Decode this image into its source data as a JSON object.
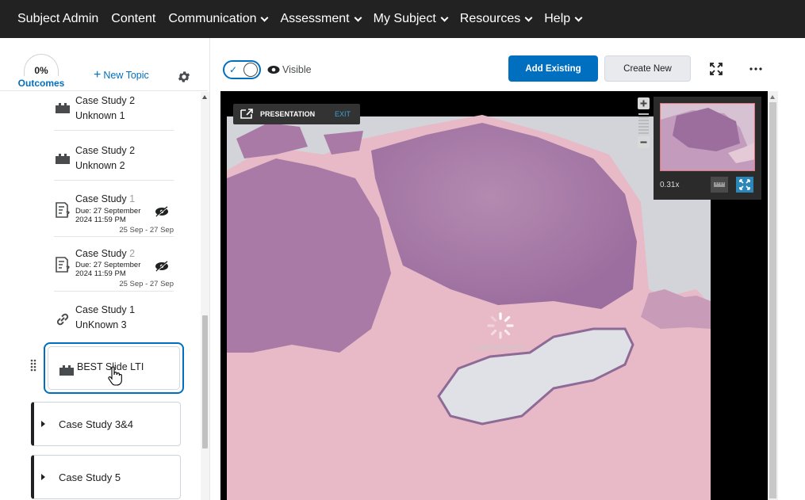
{
  "nav": {
    "items": [
      {
        "label": "Subject Admin",
        "dropdown": false
      },
      {
        "label": "Content",
        "dropdown": false
      },
      {
        "label": "Communication",
        "dropdown": true
      },
      {
        "label": "Assessment",
        "dropdown": true
      },
      {
        "label": "My Subject",
        "dropdown": true
      },
      {
        "label": "Resources",
        "dropdown": true
      },
      {
        "label": "Help",
        "dropdown": true
      }
    ]
  },
  "sidebar": {
    "outcomes_value": "0%",
    "outcomes_label": "Outcomes",
    "new_topic_label": "New Topic",
    "topics": [
      {
        "title": "Case Study 2",
        "title2": "Unknown 1",
        "icon": "lti-icon"
      },
      {
        "title": "Case Study 2",
        "title2": "Unknown 2",
        "icon": "lti-icon"
      },
      {
        "title_main": "Case Study ",
        "title_num": "1",
        "due": "Due: 27 September",
        "due2": "2024 11:59 PM",
        "dates": "25 Sep - 27 Sep",
        "icon": "quiz-icon"
      },
      {
        "title_main": "Case Study ",
        "title_num": "2",
        "due": "Due: 27 September",
        "due2": "2024 11:59 PM",
        "dates": "25 Sep - 27 Sep",
        "icon": "quiz-icon"
      },
      {
        "title": "Case Study 1",
        "title2": "UnKnown 3",
        "icon": "link-icon"
      }
    ],
    "selected_topic": "BEST Slide LTI",
    "units": [
      "Case Study 3&4",
      "Case Study 5"
    ]
  },
  "toolbar": {
    "visible_label": "Visible",
    "add_existing_label": "Add Existing",
    "create_new_label": "Create New"
  },
  "viewer": {
    "presentation_label": "PRESENTATION",
    "exit_label": "EXIT",
    "loading_label": "Loading layers...",
    "zoom_level": "0.31x"
  },
  "colors": {
    "nav_bg": "#222222",
    "accent": "#006fbf",
    "viewer_bg": "#000000",
    "tissue_light": "#e8b9c6",
    "tissue_dark": "#9c6e9f"
  }
}
